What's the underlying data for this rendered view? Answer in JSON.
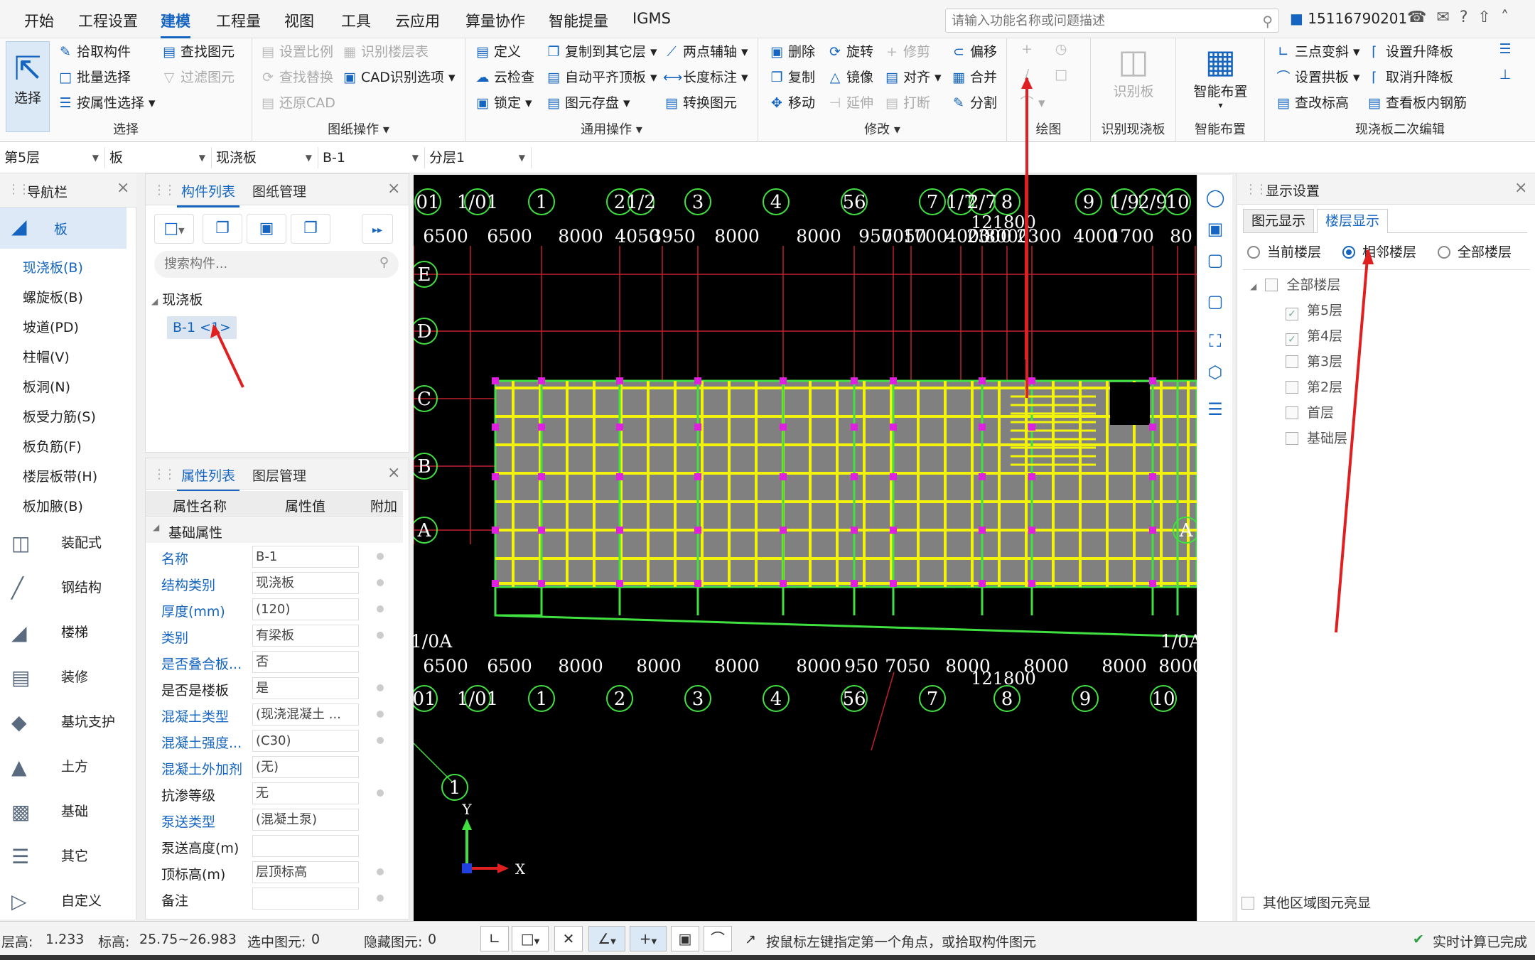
{
  "menu": [
    "开始",
    "工程设置",
    "建模",
    "工程量",
    "视图",
    "工具",
    "云应用",
    "算量协作",
    "智能提量",
    "IGMS"
  ],
  "search": {
    "placeholder": "请输入功能名称或问题描述"
  },
  "user": "15116790201",
  "ribbon": {
    "select": {
      "label": "选择",
      "items": [
        "拾取构件",
        "批量选择",
        "按属性选择",
        "查找图元",
        "过滤图元"
      ]
    },
    "drawing": {
      "label": "图纸操作",
      "items": [
        "设置比例",
        "识别楼层表",
        "查找替换",
        "CAD识别选项",
        "还原CAD"
      ]
    },
    "general": {
      "label": "通用操作",
      "items": [
        "定义",
        "复制到其它层",
        "两点辅轴",
        "云检查",
        "自动平齐顶板",
        "长度标注",
        "锁定",
        "图元存盘",
        "转换图元"
      ]
    },
    "modify": {
      "label": "修改",
      "items": [
        "删除",
        "旋转",
        "修剪",
        "偏移",
        "复制",
        "镜像",
        "对齐",
        "合并",
        "移动",
        "延伸",
        "打断",
        "分割"
      ]
    },
    "draw": {
      "label": "绘图"
    },
    "recog": {
      "label": "识别现浇板",
      "btn": "识别板"
    },
    "smart": {
      "label": "智能布置",
      "btn": "智能布置"
    },
    "slab2": {
      "label": "现浇板二次编辑",
      "items": [
        "三点变斜",
        "设置升降板",
        "设置拱板",
        "取消升降板",
        "查改标高",
        "查看板内钢筋"
      ]
    }
  },
  "filters": [
    "第5层",
    "板",
    "现浇板",
    "B-1",
    "分层1"
  ],
  "nav": {
    "title": "导航栏",
    "selected": "板",
    "subs": [
      "现浇板(B)",
      "螺旋板(B)",
      "坡道(PD)",
      "柱帽(V)",
      "板洞(N)",
      "板受力筋(S)",
      "板负筋(F)",
      "楼层板带(H)",
      "板加腋(B)"
    ],
    "cats": [
      "装配式",
      "钢结构",
      "楼梯",
      "装修",
      "基坑支护",
      "土方",
      "基础",
      "其它",
      "自定义"
    ]
  },
  "components": {
    "tabs": [
      "构件列表",
      "图纸管理"
    ],
    "search_placeholder": "搜索构件...",
    "tree_root": "现浇板",
    "item": "B-1 <1>"
  },
  "properties": {
    "tabs": [
      "属性列表",
      "图层管理"
    ],
    "headers": [
      "属性名称",
      "属性值",
      "附加"
    ],
    "group": "基础属性",
    "rows": [
      {
        "name": "名称",
        "value": "B-1"
      },
      {
        "name": "结构类别",
        "value": "现浇板"
      },
      {
        "name": "厚度(mm)",
        "value": "(120)"
      },
      {
        "name": "类别",
        "value": "有梁板"
      },
      {
        "name": "是否叠合板...",
        "value": "否"
      },
      {
        "name": "是否是楼板",
        "value": "是"
      },
      {
        "name": "混凝土类型",
        "value": "(现浇混凝土 ..."
      },
      {
        "name": "混凝土强度...",
        "value": "(C30)"
      },
      {
        "name": "混凝土外加剂",
        "value": "(无)"
      },
      {
        "name": "抗渗等级",
        "value": "无"
      },
      {
        "name": "泵送类型",
        "value": "(混凝土泵)"
      },
      {
        "name": "泵送高度(m)",
        "value": ""
      },
      {
        "name": "顶标高(m)",
        "value": "层顶标高"
      },
      {
        "name": "备注",
        "value": ""
      }
    ]
  },
  "canvas": {
    "top_axes": [
      "01",
      "1/01",
      "1",
      "2",
      "1/2",
      "3",
      "4",
      "56",
      "7",
      "1/7",
      "2/7",
      "8",
      "9",
      "1/9",
      "2/9",
      "10"
    ],
    "top_dims": [
      "6500",
      "6500",
      "8000",
      "4050",
      "3950",
      "8000",
      "8000",
      "950",
      "7050",
      "1700",
      "4000",
      "2300",
      "8000",
      "2300",
      "4000",
      "1700",
      "80"
    ],
    "top_total": "121800",
    "rows": [
      "E",
      "D",
      "C",
      "B",
      "A"
    ],
    "bottom_axes": [
      "01",
      "1/01",
      "1",
      "2",
      "3",
      "4",
      "56",
      "7",
      "8",
      "9",
      "10"
    ],
    "bottom_dims": [
      "6500",
      "6500",
      "8000",
      "8000",
      "8000",
      "8000",
      "950",
      "7050",
      "8000",
      "8000",
      "8000",
      "8000"
    ],
    "bottom_total": "121800",
    "left_label": "1/0A",
    "right_label": "1/0A",
    "right_row": "A",
    "extra_axis": "1",
    "x_label": "X",
    "y_label": "Y"
  },
  "display": {
    "title": "显示设置",
    "tabs": [
      "图元显示",
      "楼层显示"
    ],
    "radios": [
      "当前楼层",
      "相邻楼层",
      "全部楼层"
    ],
    "all_floors": "全部楼层",
    "floors": [
      {
        "n": "第5层",
        "c": true
      },
      {
        "n": "第4层",
        "c": true
      },
      {
        "n": "第3层",
        "c": false
      },
      {
        "n": "第2层",
        "c": false
      },
      {
        "n": "首层",
        "c": false
      },
      {
        "n": "基础层",
        "c": false
      }
    ],
    "footer": "其他区域图元亮显"
  },
  "status": {
    "floor_h": "层高:",
    "floor_h_v": "1.233",
    "elev": "标高:",
    "elev_v": "25.75~26.983",
    "sel": "选中图元:",
    "sel_v": "0",
    "hid": "隐藏图元:",
    "hid_v": "0",
    "hint": "按鼠标左键指定第一个角点，或拾取构件图元",
    "calc": "实时计算已完成"
  }
}
